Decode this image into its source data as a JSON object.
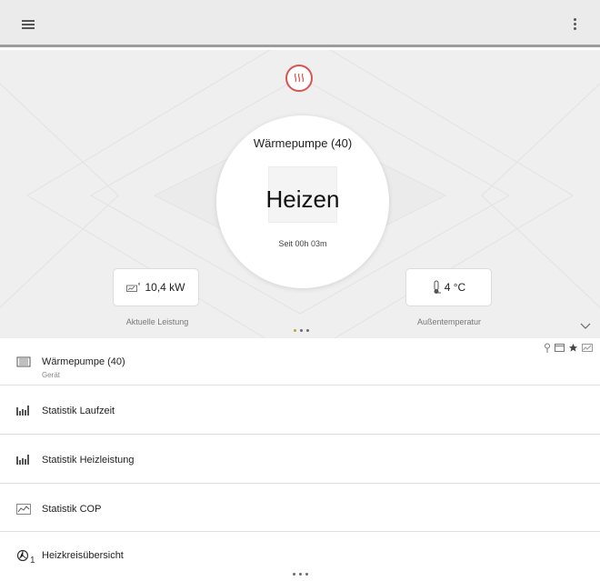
{
  "header": {
    "menu_icon": "hamburger-icon",
    "more_icon": "more-vert-icon"
  },
  "hero": {
    "mode_icon": "heating-icon",
    "device_name": "Wärmepumpe (40)",
    "state": "Heizen",
    "since": "Seit 00h 03m",
    "left_tile": {
      "icon": "power-meter-icon",
      "value": "10,4 kW",
      "label": "Aktuelle Leistung"
    },
    "right_tile": {
      "icon": "thermometer-icon",
      "value": "4 °C",
      "label": "Außentemperatur"
    },
    "pager_dots": 3,
    "pager_active_index": 0,
    "expand_icon": "chevron-down-icon"
  },
  "list": {
    "items": [
      {
        "icon": "device-icon",
        "title": "Wärmepumpe (40)",
        "subtitle": "Gerät"
      },
      {
        "icon": "bar-chart-icon",
        "title": "Statistik Laufzeit"
      },
      {
        "icon": "bar-chart-icon",
        "title": "Statistik Heizleistung"
      },
      {
        "icon": "line-chart-icon",
        "title": "Statistik COP"
      },
      {
        "icon": "heating-circuit-icon",
        "title": "Heizkreisübersicht"
      }
    ],
    "tools": [
      "pin-icon",
      "window-icon",
      "star-icon",
      "chart-icon"
    ],
    "pager_dots": 3
  },
  "colors": {
    "accent": "#d9534f",
    "pager_active": "#b5a733",
    "topbar": "#ebebeb"
  }
}
